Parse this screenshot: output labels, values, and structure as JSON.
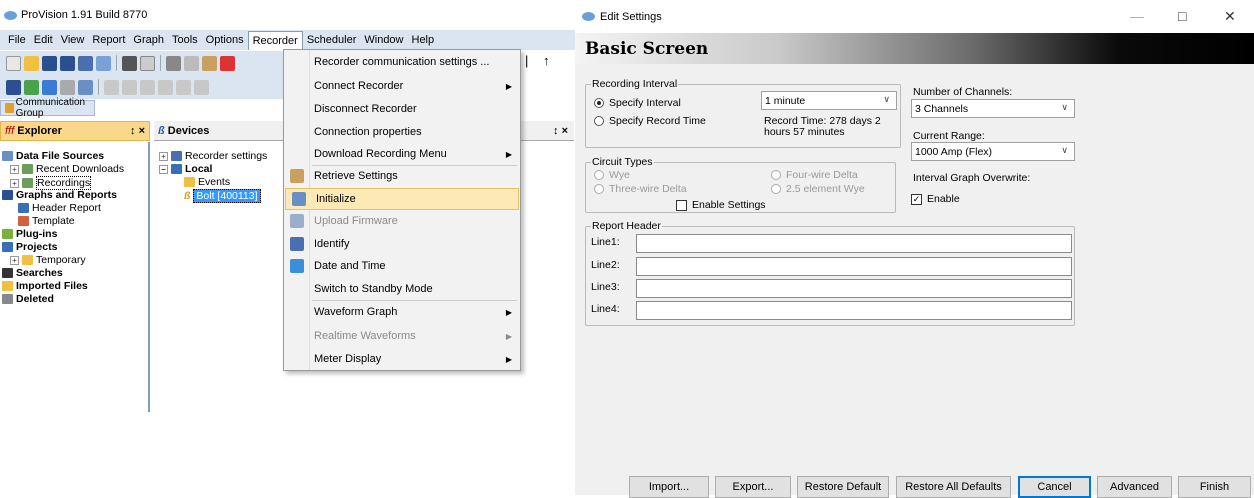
{
  "app": {
    "title": "ProVision 1.91 Build 8770",
    "menu": [
      "File",
      "Edit",
      "View",
      "Report",
      "Graph",
      "Tools",
      "Options",
      "Recorder",
      "Scheduler",
      "Window",
      "Help"
    ],
    "comm_group": "Communication Group",
    "explorer_title": "Explorer",
    "devices_title": "Devices",
    "pin_glyph": "↕",
    "close_glyph": "×",
    "toolbar_tail": "↑",
    "toolbar_tail2": "|",
    "explorer_tree": [
      {
        "label": "Data File Sources",
        "bold": true
      },
      {
        "label": "Recent Downloads",
        "bold": false
      },
      {
        "label": "Recordings",
        "bold": false
      },
      {
        "label": "Graphs and Reports",
        "bold": true
      },
      {
        "label": "Header Report",
        "bold": false
      },
      {
        "label": "Template",
        "bold": false
      },
      {
        "label": "Plug-ins",
        "bold": true
      },
      {
        "label": "Projects",
        "bold": true
      },
      {
        "label": "Temporary",
        "bold": false
      },
      {
        "label": "Searches",
        "bold": true
      },
      {
        "label": "Imported Files",
        "bold": true
      },
      {
        "label": "Deleted",
        "bold": true
      }
    ],
    "devices_tree": [
      {
        "label": "Recorder settings"
      },
      {
        "label": "Local"
      },
      {
        "label": "Events"
      },
      {
        "label": "Bolt [400113]"
      }
    ]
  },
  "recorder_menu": {
    "items": [
      {
        "label": "Recorder communication settings ...",
        "disabled": false,
        "submenu": false,
        "highlighted": false,
        "icon": ""
      },
      {
        "label": "Connect Recorder",
        "disabled": false,
        "submenu": true,
        "highlighted": false,
        "icon": ""
      },
      {
        "label": "Disconnect Recorder",
        "disabled": false,
        "submenu": false,
        "highlighted": false,
        "icon": ""
      },
      {
        "label": "Connection properties",
        "disabled": false,
        "submenu": false,
        "highlighted": false,
        "icon": ""
      },
      {
        "label": "Download Recording Menu",
        "disabled": false,
        "submenu": true,
        "highlighted": false,
        "icon": ""
      },
      {
        "label": "Retrieve Settings",
        "disabled": false,
        "submenu": false,
        "highlighted": false,
        "icon": "retrieve-icon"
      },
      {
        "label": "Initialize",
        "disabled": false,
        "submenu": false,
        "highlighted": true,
        "icon": "initialize-icon"
      },
      {
        "label": "Upload Firmware",
        "disabled": true,
        "submenu": false,
        "highlighted": false,
        "icon": "upload-icon"
      },
      {
        "label": "Identify",
        "disabled": false,
        "submenu": false,
        "highlighted": false,
        "icon": "identify-icon"
      },
      {
        "label": "Date and Time",
        "disabled": false,
        "submenu": false,
        "highlighted": false,
        "icon": "clock-icon"
      },
      {
        "label": "Switch to Standby Mode",
        "disabled": false,
        "submenu": false,
        "highlighted": false,
        "icon": ""
      },
      {
        "label": "Waveform Graph",
        "disabled": false,
        "submenu": true,
        "highlighted": false,
        "icon": ""
      },
      {
        "label": "Realtime Waveforms",
        "disabled": true,
        "submenu": true,
        "highlighted": false,
        "icon": ""
      },
      {
        "label": "Meter Display",
        "disabled": false,
        "submenu": true,
        "highlighted": false,
        "icon": ""
      }
    ],
    "arrow_glyph": "▶"
  },
  "dialog": {
    "title": "Edit Settings",
    "banner": "Basic Screen",
    "window_controls": {
      "minimize": "—",
      "maximize": "□",
      "close": "✕"
    },
    "dropdown_glyph": "∨",
    "recording_interval": {
      "label": "Recording Interval",
      "specify_interval": "Specify Interval",
      "specify_record_time": "Specify Record Time",
      "interval_value": "1 minute",
      "record_time_text": "Record Time: 278 days 2 hours 57 minutes"
    },
    "circuit_types": {
      "label": "Circuit Types",
      "wye": "Wye",
      "three_wire_delta": "Three-wire Delta",
      "four_wire_delta": "Four-wire Delta",
      "two_five_element_wye": "2.5 element Wye",
      "enable_settings": "Enable Settings"
    },
    "channels": {
      "label": "Number of Channels:",
      "value": "3 Channels"
    },
    "current_range": {
      "label": "Current Range:",
      "value": "1000 Amp (Flex)"
    },
    "interval_graph": {
      "label": "Interval Graph Overwrite:",
      "enable_label": "Enable",
      "checked": true,
      "check_glyph": "✓"
    },
    "report_header": {
      "label": "Report Header",
      "lines": [
        {
          "label": "Line1:",
          "value": ""
        },
        {
          "label": "Line2:",
          "value": ""
        },
        {
          "label": "Line3:",
          "value": ""
        },
        {
          "label": "Line4:",
          "value": ""
        }
      ]
    },
    "buttons": {
      "import": "Import...",
      "export": "Export...",
      "restore_default": "Restore Default",
      "restore_all": "Restore All Defaults",
      "cancel": "Cancel",
      "advanced": "Advanced",
      "finish": "Finish"
    }
  },
  "colors": {
    "explorer_header": "#fbd789",
    "menu_highlight": "#fde9b5",
    "selected_node": "#3399ff"
  }
}
